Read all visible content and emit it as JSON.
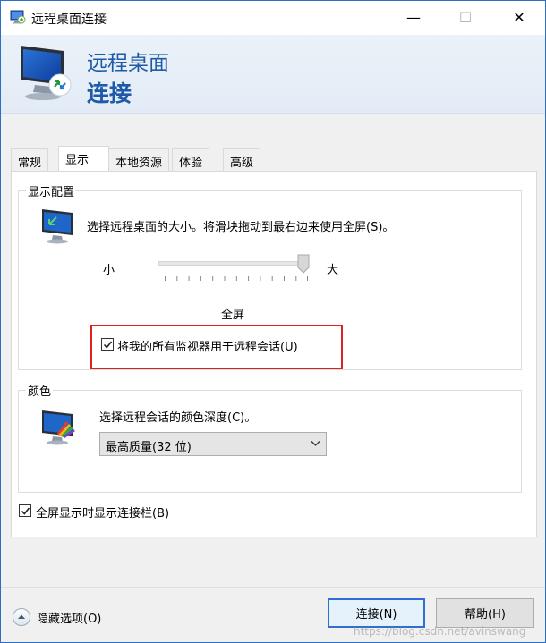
{
  "window": {
    "title": "远程桌面连接",
    "min_glyph": "—",
    "max_glyph": "☐",
    "close_glyph": "✕"
  },
  "banner": {
    "line1": "远程桌面",
    "line2": "连接"
  },
  "tabs": [
    {
      "label": "常规",
      "active": false
    },
    {
      "label": "显示",
      "active": true
    },
    {
      "label": "本地资源",
      "active": false
    },
    {
      "label": "体验",
      "active": false
    },
    {
      "label": "高级",
      "active": false
    }
  ],
  "display_config": {
    "group_title": "显示配置",
    "description": "选择远程桌面的大小。将滑块拖动到最右边来使用全屏(S)。",
    "slider_min_label": "小",
    "slider_max_label": "大",
    "slider_level": 1.0,
    "slider_value_label": "全屏",
    "multi_monitor_checkbox": {
      "label": "将我的所有监视器用于远程会话(U)",
      "checked": true
    }
  },
  "color": {
    "group_title": "颜色",
    "description": "选择远程会话的颜色深度(C)。",
    "selected": "最高质量(32 位)"
  },
  "connection_bar_checkbox": {
    "label": "全屏显示时显示连接栏(B)",
    "checked": true
  },
  "footer": {
    "hide_options": "隐藏选项(O)",
    "connect_button": "连接(N)",
    "help_button": "帮助(H)",
    "watermark": "https://blog.csdn.net/avinswang"
  },
  "colors": {
    "accent": "#1e5aa8",
    "highlight": "#e02020",
    "window_border": "#2b6fc4"
  }
}
